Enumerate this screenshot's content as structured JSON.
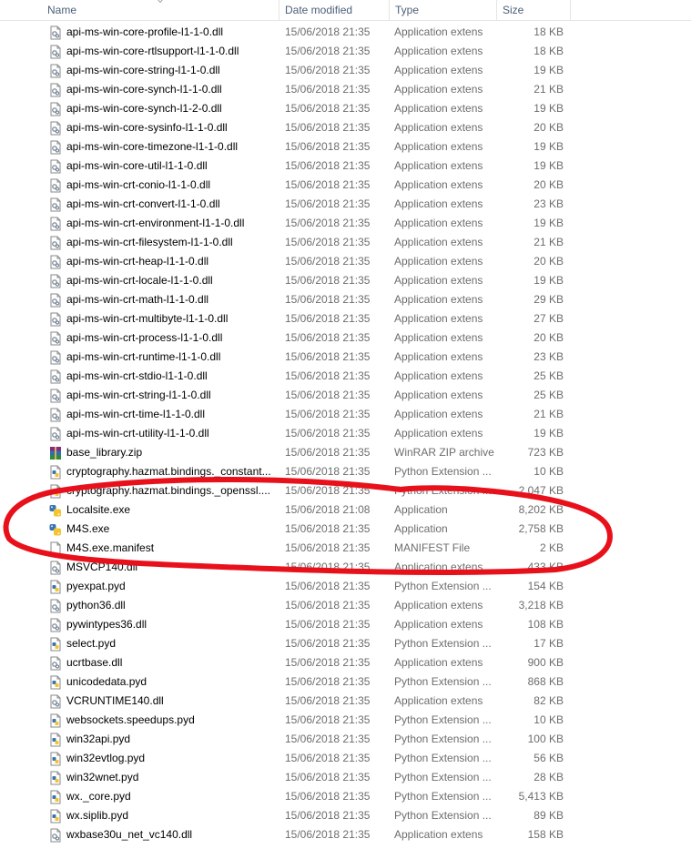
{
  "columns": {
    "name": "Name",
    "date_modified": "Date modified",
    "type": "Type",
    "size": "Size"
  },
  "files": [
    {
      "name": "api-ms-win-core-profile-l1-1-0.dll",
      "date": "15/06/2018 21:35",
      "type": "Application extens",
      "size": "18 KB",
      "icon": "dll-icon"
    },
    {
      "name": "api-ms-win-core-rtlsupport-l1-1-0.dll",
      "date": "15/06/2018 21:35",
      "type": "Application extens",
      "size": "18 KB",
      "icon": "dll-icon"
    },
    {
      "name": "api-ms-win-core-string-l1-1-0.dll",
      "date": "15/06/2018 21:35",
      "type": "Application extens",
      "size": "19 KB",
      "icon": "dll-icon"
    },
    {
      "name": "api-ms-win-core-synch-l1-1-0.dll",
      "date": "15/06/2018 21:35",
      "type": "Application extens",
      "size": "21 KB",
      "icon": "dll-icon"
    },
    {
      "name": "api-ms-win-core-synch-l1-2-0.dll",
      "date": "15/06/2018 21:35",
      "type": "Application extens",
      "size": "19 KB",
      "icon": "dll-icon"
    },
    {
      "name": "api-ms-win-core-sysinfo-l1-1-0.dll",
      "date": "15/06/2018 21:35",
      "type": "Application extens",
      "size": "20 KB",
      "icon": "dll-icon"
    },
    {
      "name": "api-ms-win-core-timezone-l1-1-0.dll",
      "date": "15/06/2018 21:35",
      "type": "Application extens",
      "size": "19 KB",
      "icon": "dll-icon"
    },
    {
      "name": "api-ms-win-core-util-l1-1-0.dll",
      "date": "15/06/2018 21:35",
      "type": "Application extens",
      "size": "19 KB",
      "icon": "dll-icon"
    },
    {
      "name": "api-ms-win-crt-conio-l1-1-0.dll",
      "date": "15/06/2018 21:35",
      "type": "Application extens",
      "size": "20 KB",
      "icon": "dll-icon"
    },
    {
      "name": "api-ms-win-crt-convert-l1-1-0.dll",
      "date": "15/06/2018 21:35",
      "type": "Application extens",
      "size": "23 KB",
      "icon": "dll-icon"
    },
    {
      "name": "api-ms-win-crt-environment-l1-1-0.dll",
      "date": "15/06/2018 21:35",
      "type": "Application extens",
      "size": "19 KB",
      "icon": "dll-icon"
    },
    {
      "name": "api-ms-win-crt-filesystem-l1-1-0.dll",
      "date": "15/06/2018 21:35",
      "type": "Application extens",
      "size": "21 KB",
      "icon": "dll-icon"
    },
    {
      "name": "api-ms-win-crt-heap-l1-1-0.dll",
      "date": "15/06/2018 21:35",
      "type": "Application extens",
      "size": "20 KB",
      "icon": "dll-icon"
    },
    {
      "name": "api-ms-win-crt-locale-l1-1-0.dll",
      "date": "15/06/2018 21:35",
      "type": "Application extens",
      "size": "19 KB",
      "icon": "dll-icon"
    },
    {
      "name": "api-ms-win-crt-math-l1-1-0.dll",
      "date": "15/06/2018 21:35",
      "type": "Application extens",
      "size": "29 KB",
      "icon": "dll-icon"
    },
    {
      "name": "api-ms-win-crt-multibyte-l1-1-0.dll",
      "date": "15/06/2018 21:35",
      "type": "Application extens",
      "size": "27 KB",
      "icon": "dll-icon"
    },
    {
      "name": "api-ms-win-crt-process-l1-1-0.dll",
      "date": "15/06/2018 21:35",
      "type": "Application extens",
      "size": "20 KB",
      "icon": "dll-icon"
    },
    {
      "name": "api-ms-win-crt-runtime-l1-1-0.dll",
      "date": "15/06/2018 21:35",
      "type": "Application extens",
      "size": "23 KB",
      "icon": "dll-icon"
    },
    {
      "name": "api-ms-win-crt-stdio-l1-1-0.dll",
      "date": "15/06/2018 21:35",
      "type": "Application extens",
      "size": "25 KB",
      "icon": "dll-icon"
    },
    {
      "name": "api-ms-win-crt-string-l1-1-0.dll",
      "date": "15/06/2018 21:35",
      "type": "Application extens",
      "size": "25 KB",
      "icon": "dll-icon"
    },
    {
      "name": "api-ms-win-crt-time-l1-1-0.dll",
      "date": "15/06/2018 21:35",
      "type": "Application extens",
      "size": "21 KB",
      "icon": "dll-icon"
    },
    {
      "name": "api-ms-win-crt-utility-l1-1-0.dll",
      "date": "15/06/2018 21:35",
      "type": "Application extens",
      "size": "19 KB",
      "icon": "dll-icon"
    },
    {
      "name": "base_library.zip",
      "date": "15/06/2018 21:35",
      "type": "WinRAR ZIP archive",
      "size": "723 KB",
      "icon": "winrar-archive-icon"
    },
    {
      "name": "cryptography.hazmat.bindings._constant...",
      "date": "15/06/2018 21:35",
      "type": "Python Extension ...",
      "size": "10 KB",
      "icon": "python-file-icon"
    },
    {
      "name": "cryptography.hazmat.bindings._openssl....",
      "date": "15/06/2018 21:35",
      "type": "Python Extension ...",
      "size": "2,047 KB",
      "icon": "python-file-icon"
    },
    {
      "name": "Localsite.exe",
      "date": "15/06/2018 21:08",
      "type": "Application",
      "size": "8,202 KB",
      "icon": "python-exe-icon"
    },
    {
      "name": "M4S.exe",
      "date": "15/06/2018 21:35",
      "type": "Application",
      "size": "2,758 KB",
      "icon": "python-exe-icon"
    },
    {
      "name": "M4S.exe.manifest",
      "date": "15/06/2018 21:35",
      "type": "MANIFEST File",
      "size": "2 KB",
      "icon": "blank-file-icon"
    },
    {
      "name": "MSVCP140.dll",
      "date": "15/06/2018 21:35",
      "type": "Application extens",
      "size": "433 KB",
      "icon": "dll-icon"
    },
    {
      "name": "pyexpat.pyd",
      "date": "15/06/2018 21:35",
      "type": "Python Extension ...",
      "size": "154 KB",
      "icon": "python-file-icon"
    },
    {
      "name": "python36.dll",
      "date": "15/06/2018 21:35",
      "type": "Application extens",
      "size": "3,218 KB",
      "icon": "dll-icon"
    },
    {
      "name": "pywintypes36.dll",
      "date": "15/06/2018 21:35",
      "type": "Application extens",
      "size": "108 KB",
      "icon": "dll-icon"
    },
    {
      "name": "select.pyd",
      "date": "15/06/2018 21:35",
      "type": "Python Extension ...",
      "size": "17 KB",
      "icon": "python-file-icon"
    },
    {
      "name": "ucrtbase.dll",
      "date": "15/06/2018 21:35",
      "type": "Application extens",
      "size": "900 KB",
      "icon": "dll-icon"
    },
    {
      "name": "unicodedata.pyd",
      "date": "15/06/2018 21:35",
      "type": "Python Extension ...",
      "size": "868 KB",
      "icon": "python-file-icon"
    },
    {
      "name": "VCRUNTIME140.dll",
      "date": "15/06/2018 21:35",
      "type": "Application extens",
      "size": "82 KB",
      "icon": "dll-icon"
    },
    {
      "name": "websockets.speedups.pyd",
      "date": "15/06/2018 21:35",
      "type": "Python Extension ...",
      "size": "10 KB",
      "icon": "python-file-icon"
    },
    {
      "name": "win32api.pyd",
      "date": "15/06/2018 21:35",
      "type": "Python Extension ...",
      "size": "100 KB",
      "icon": "python-file-icon"
    },
    {
      "name": "win32evtlog.pyd",
      "date": "15/06/2018 21:35",
      "type": "Python Extension ...",
      "size": "56 KB",
      "icon": "python-file-icon"
    },
    {
      "name": "win32wnet.pyd",
      "date": "15/06/2018 21:35",
      "type": "Python Extension ...",
      "size": "28 KB",
      "icon": "python-file-icon"
    },
    {
      "name": "wx._core.pyd",
      "date": "15/06/2018 21:35",
      "type": "Python Extension ...",
      "size": "5,413 KB",
      "icon": "python-file-icon"
    },
    {
      "name": "wx.siplib.pyd",
      "date": "15/06/2018 21:35",
      "type": "Python Extension ...",
      "size": "89 KB",
      "icon": "python-file-icon"
    },
    {
      "name": "wxbase30u_net_vc140.dll",
      "date": "15/06/2018 21:35",
      "type": "Application extens",
      "size": "158 KB",
      "icon": "dll-icon"
    }
  ],
  "annotation": {
    "shape": "red-freehand-ellipse",
    "color": "#e8111b",
    "highlights": [
      "Localsite.exe",
      "M4S.exe",
      "M4S.exe.manifest"
    ]
  }
}
